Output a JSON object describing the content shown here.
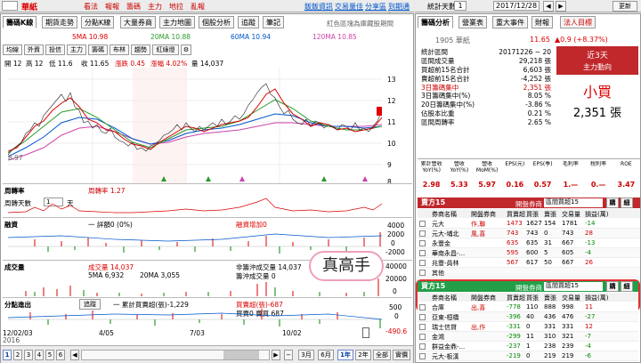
{
  "topbar": {
    "code": "1905",
    "name": "華紙",
    "menu": [
      "看法",
      "報報",
      "籌碼",
      "主力",
      "地拉",
      "亂報"
    ],
    "links": [
      "飯飯資訊",
      "交易量佳",
      "分享區",
      "到期通知"
    ],
    "date_label": "統計天數",
    "date_value": "2017/12/28",
    "days": "1",
    "update": "更新"
  },
  "tabs": [
    "籌碼K線",
    "期貨走勢",
    "分點K線",
    "大量券商",
    "主力地圖",
    "個股分析",
    "追蹤",
    "筆記"
  ],
  "note": "紅色區塊為庫藏股期間",
  "ma": {
    "ma5": "5MA 10.98",
    "ma20": "20MA 10.88",
    "ma60": "60MA 10.94",
    "ma120": "120MA 10.85"
  },
  "subbtns": [
    "均線",
    "外資",
    "投信",
    "主力",
    "籌碼",
    "布林",
    "趨勢",
    "紅綠燈"
  ],
  "ohlc": {
    "open": "開 12",
    "high": "高 12",
    "low": "低 11.6",
    "close": "收 11.65",
    "chg": "漲跌 0.45",
    "pct": "漲幅 4.02%",
    "vol": "量 14,037"
  },
  "yaxis": [
    "13",
    "12",
    "11",
    "10",
    "9",
    "8"
  ],
  "price_tag": "11.65",
  "price_min": "8.97",
  "panes": {
    "turnover": {
      "title": "周轉率",
      "legend": "周轉率 1.27",
      "days_label": "周轉天數",
      "days": "1",
      "unit": "天"
    },
    "margin": {
      "title": "融資",
      "legend1": "一 詳額0 (0%)",
      "legend2": "融資增加0",
      "axis": [
        "4000",
        "2000",
        "0",
        "-2000"
      ]
    },
    "vol": {
      "title": "成交量",
      "legend1": "成交量 14,037",
      "legend2": "5MA 6,932",
      "legend3": "20MA 3,055",
      "legend4": "非籌沖成交量 14,037",
      "legend5": "籌沖成交量 0",
      "axis": [
        "40000",
        "20000",
        "0"
      ],
      "stamp": "真高手"
    },
    "branch": {
      "title": "分點進出",
      "btn": "追蹤",
      "legend1": "一 累計買賣超(張)-1,229",
      "legend2": "買賣超(張)-687",
      "legend3": "買賣0 賣買 687",
      "axis": [
        "500",
        "0"
      ],
      "neg": "-490.6"
    }
  },
  "xaxis": {
    "left1": "12/02/03",
    "left2": "2016",
    "left3": "2017",
    "m1": "4/05",
    "m2": "7/03",
    "m3": "10/02"
  },
  "pager": [
    "1",
    "2",
    "3",
    "4",
    "5",
    "6"
  ],
  "ranges": [
    "3月",
    "6月",
    "1年",
    "2年",
    "全部",
    "實價"
  ],
  "right": {
    "tabs": [
      "籌碼分析",
      "營業表",
      "重大事件",
      "財報",
      "法人目標"
    ],
    "stock_line": "1905 華紙",
    "price": "11.65",
    "chg": "▲0.9 (+8.37%)",
    "rows": [
      [
        "統計區間",
        "20171226 ~ 20"
      ],
      [
        "區間成交量",
        "29,218 張"
      ],
      [
        "買超前15名合計",
        "6,603 張"
      ],
      [
        "賣超前15名合計",
        "-4,252 張"
      ],
      [
        "3日籌碼集中",
        "2,351 張"
      ],
      [
        "3日籌碼集中(%)",
        "8.05 %"
      ],
      [
        "20日籌碼集中(%)",
        "-3.86 %"
      ],
      [
        "佔股本比重",
        "0.21 %"
      ],
      [
        "區間周轉率",
        "2.65 %"
      ]
    ],
    "box_title": "近3天",
    "box_sub": "主力動向",
    "box_main": "小買",
    "box_val": "2,351 張",
    "fin_head": [
      "累計營收YoY(%)",
      "營收YoY(%)",
      "營收MoM(%)",
      "EPS(元)",
      "EPS(季)",
      "毛利率",
      "稅利率",
      "ROE"
    ],
    "fin_vals": [
      "2.98",
      "5.33",
      "5.97",
      "0.16",
      "0.57",
      "1.—",
      "0.—",
      "3.47"
    ],
    "sell_title": "賣方15",
    "buy_title": "買方15",
    "filter_label": "開盤券商",
    "filter_val": "區間買超15",
    "go": "購",
    "chk": "細",
    "cols": [
      "券商名稱",
      "開盤券商",
      "買賣超",
      "買張",
      "賣張",
      "交易量",
      "損益(萬)"
    ],
    "sell_rows": [
      [
        "元大",
        "作,聯",
        "1473",
        "1627",
        "154",
        "1781",
        "-14"
      ],
      [
        "元大-埔北",
        "風,喜",
        "743",
        "743",
        "0",
        "743",
        "28"
      ],
      [
        "永豐金",
        "",
        "635",
        "635",
        "31",
        "667",
        "-13"
      ],
      [
        "華南永昌-...",
        "",
        "595",
        "600",
        "5",
        "605",
        "-4"
      ],
      [
        "兆豐-員林",
        "",
        "567",
        "617",
        "50",
        "667",
        "26"
      ],
      [
        "其他",
        "",
        "",
        "",
        "",
        "",
        ""
      ]
    ],
    "buy_rows": [
      [
        "合庫",
        "出,喜",
        "-778",
        "110",
        "888",
        "998",
        "11"
      ],
      [
        "亞東-桓橋",
        "",
        "-396",
        "40",
        "436",
        "476",
        "-27"
      ],
      [
        "瑞士信貸",
        "出,作",
        "-331",
        "0",
        "331",
        "331",
        "12"
      ],
      [
        "金鴻",
        "",
        "-299",
        "11",
        "310",
        "321",
        "-7"
      ],
      [
        "群益金鼎-...",
        "",
        "-237",
        "1",
        "238",
        "239",
        "-4"
      ],
      [
        "元大-板漢",
        "",
        "-219",
        "0",
        "219",
        "219",
        "-6"
      ]
    ]
  }
}
